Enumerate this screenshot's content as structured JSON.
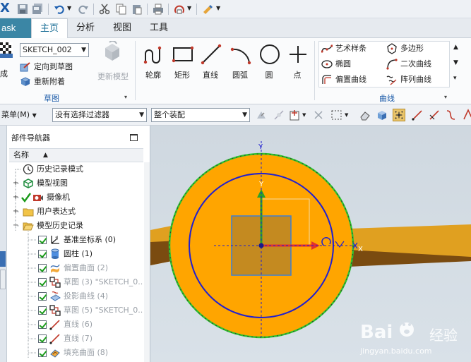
{
  "app": {
    "logo": "X"
  },
  "tabs": {
    "task": "ask",
    "items": [
      {
        "label": "主页",
        "active": true
      },
      {
        "label": "分析",
        "active": false
      },
      {
        "label": "视图",
        "active": false
      },
      {
        "label": "工具",
        "active": false
      }
    ]
  },
  "ribbon": {
    "sketch_group": {
      "left_partial_label": "成",
      "sketch_name": "SKETCH_002",
      "orient_label": "定向到草图",
      "reattach_label": "重新附着",
      "update_label": "更新模型",
      "group_label": "草图"
    },
    "tools": [
      {
        "label": "轮廓",
        "icon": "profile-icon"
      },
      {
        "label": "矩形",
        "icon": "rectangle-icon"
      },
      {
        "label": "直线",
        "icon": "line-icon"
      },
      {
        "label": "圆弧",
        "icon": "arc-icon"
      },
      {
        "label": "圆",
        "icon": "circle-icon"
      },
      {
        "label": "点",
        "icon": "point-icon"
      }
    ],
    "curve_group": {
      "items": [
        {
          "label": "艺术样条",
          "icon": "studio-spline-icon"
        },
        {
          "label": "多边形",
          "icon": "polygon-icon"
        },
        {
          "label": "椭圆",
          "icon": "ellipse-icon"
        },
        {
          "label": "二次曲线",
          "icon": "conic-icon"
        },
        {
          "label": "偏置曲线",
          "icon": "offset-curve-icon"
        },
        {
          "label": "阵列曲线",
          "icon": "pattern-curve-icon"
        }
      ],
      "group_label": "曲线"
    }
  },
  "toolbar2": {
    "menu_label": "菜单(M)",
    "filter_value": "没有选择过滤器",
    "assembly_value": "整个装配"
  },
  "navigator": {
    "title": "部件导航器",
    "column_header": "名称",
    "rows": [
      {
        "label": "历史记录模式",
        "icon": "clock-icon",
        "grey": false
      },
      {
        "label": "模型视图",
        "icon": "model-views-icon",
        "grey": false
      },
      {
        "label": "摄像机",
        "icon": "camera-icon",
        "grey": false
      },
      {
        "label": "用户表达式",
        "icon": "folder-icon",
        "grey": false
      },
      {
        "label": "模型历史记录",
        "icon": "folder-open-icon",
        "grey": false
      },
      {
        "label": "基准坐标系 (0)",
        "icon": "datum-csys-icon",
        "grey": false
      },
      {
        "label": "圆柱 (1)",
        "icon": "cylinder-icon",
        "grey": false
      },
      {
        "label": "偏置曲面 (2)",
        "icon": "offset-surface-icon",
        "grey": true
      },
      {
        "label": "草图 (3) \"SKETCH_0..",
        "icon": "sketch-icon",
        "grey": true
      },
      {
        "label": "投影曲线 (4)",
        "icon": "projected-curve-icon",
        "grey": true
      },
      {
        "label": "草图 (5) \"SKETCH_0..",
        "icon": "sketch-icon",
        "grey": true
      },
      {
        "label": "直线 (6)",
        "icon": "line-feature-icon",
        "grey": true
      },
      {
        "label": "直线 (7)",
        "icon": "line-feature-icon",
        "grey": true
      },
      {
        "label": "填充曲面 (8)",
        "icon": "fill-surface-icon",
        "grey": true
      }
    ]
  },
  "canvas": {
    "axis_y_label": "Y",
    "axis_y_label_top": "Y",
    "axis_x_label": "X",
    "colors": {
      "body": "#ffa500",
      "edge_green": "#2fc42f",
      "inner_circle": "#2020d0",
      "csys_square": "#3d7fd6",
      "x_axis": "#e03030",
      "y_axis": "#2aa02a"
    }
  },
  "watermark": {
    "brand": "Bai 经验",
    "url": "jingyan.baidu.com"
  }
}
